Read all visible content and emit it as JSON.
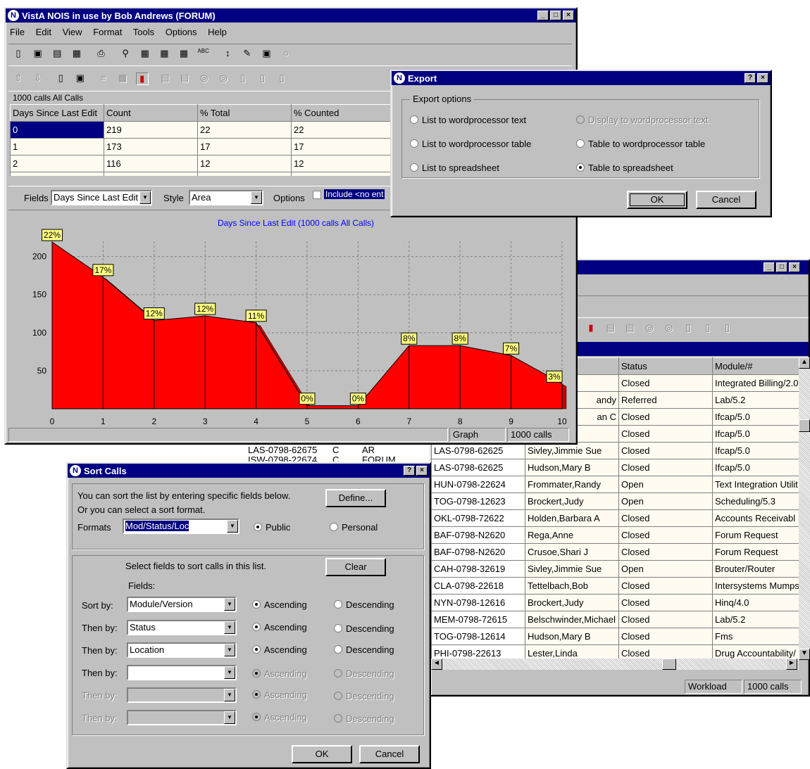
{
  "main": {
    "title": "VistA NOIS in use by Bob Andrews (FORUM)",
    "menu": [
      "File",
      "Edit",
      "View",
      "Format",
      "Tools",
      "Options",
      "Help"
    ],
    "summary": "1000 calls  All Calls",
    "columns": [
      "Days Since Last Edit",
      "Count",
      "% Total",
      "% Counted"
    ],
    "rows": [
      [
        "0",
        "219",
        "22",
        "22"
      ],
      [
        "1",
        "173",
        "17",
        "17"
      ],
      [
        "2",
        "116",
        "12",
        "12"
      ]
    ],
    "fields_label": "Fields",
    "fields_value": "Days Since Last Edit",
    "style_label": "Style",
    "style_value": "Area",
    "options_label": "Options",
    "options_check": "Include <no ent",
    "status_mode": "Graph",
    "status_count": "1000 calls"
  },
  "chart_data": {
    "type": "area",
    "title": "Days Since Last Edit (1000 calls   All Calls)",
    "x": [
      0,
      1,
      2,
      3,
      4,
      5,
      6,
      7,
      8,
      9,
      10
    ],
    "values": [
      219,
      173,
      116,
      122,
      113,
      4,
      4,
      83,
      83,
      70,
      33
    ],
    "labels": [
      "22%",
      "17%",
      "12%",
      "12%",
      "11%",
      "0%",
      "0%",
      "8%",
      "8%",
      "7%",
      "3%"
    ],
    "yticks": [
      50,
      100,
      150,
      200
    ],
    "ylim": [
      0,
      220
    ],
    "xlim": [
      0,
      10
    ],
    "grid": true,
    "fill_color": "#ff0000",
    "label_bg": "#ffff80"
  },
  "export": {
    "title": "Export",
    "group": "Export options",
    "opt_list_wp_text": "List to wordprocessor text",
    "opt_display_wp_text": "Display to wordprocessor text",
    "opt_list_wp_table": "List to wordprocessor table",
    "opt_table_wp_table": "Table to wordprocessor table",
    "opt_list_ss": "List to spreadsheet",
    "opt_table_ss": "Table to spreadsheet",
    "ok": "OK",
    "cancel": "Cancel"
  },
  "list": {
    "columns": [
      "",
      "Status",
      "Module/#"
    ],
    "rows": [
      [
        "",
        "Closed",
        "Integrated Billing/2.0"
      ],
      [
        "andy",
        "Referred",
        "Lab/5.2"
      ],
      [
        "an C",
        "Closed",
        "Ifcap/5.0"
      ],
      [
        "",
        "Closed",
        "Ifcap/5.0"
      ],
      [
        "LAS-0798-62625",
        "Sivley,Jimmie Sue",
        "Closed",
        "Ifcap/5.0"
      ],
      [
        "LAS-0798-62625",
        "Hudson,Mary B",
        "Closed",
        "Ifcap/5.0"
      ],
      [
        "HUN-0798-22624",
        "Frommater,Randy",
        "Open",
        "Text Integration Utilit"
      ],
      [
        "TOG-0798-12623",
        "Brockert,Judy",
        "Open",
        "Scheduling/5.3"
      ],
      [
        "OKL-0798-72622",
        "Holden,Barbara A",
        "Closed",
        "Accounts Receivabl"
      ],
      [
        "BAF-0798-N2620",
        "Rega,Anne",
        "Closed",
        "Forum Request"
      ],
      [
        "BAF-0798-N2620",
        "Crusoe,Shari J",
        "Closed",
        "Forum Request"
      ],
      [
        "CAH-0798-32619",
        "Sivley,Jimmie Sue",
        "Open",
        "Brouter/Router"
      ],
      [
        "CLA-0798-22618",
        "Tettelbach,Bob",
        "Closed",
        "Intersystems Mumps"
      ],
      [
        "NYN-0798-12616",
        "Brockert,Judy",
        "Closed",
        "Hinq/4.0"
      ],
      [
        "MEM-0798-72615",
        "Belschwinder,Michael",
        "Closed",
        "Lab/5.2"
      ],
      [
        "TOG-0798-12614",
        "Hudson,Mary B",
        "Closed",
        "Fms"
      ],
      [
        "PHI-0798-22613",
        "Lester,Linda",
        "Closed",
        "Drug Accountability/"
      ]
    ],
    "peek1": [
      "LAS-0798-62675",
      "C",
      "AR"
    ],
    "peek2": [
      "ISW-0798-22674",
      "C",
      "FORUM"
    ],
    "status_mode": "Workload",
    "status_count": "1000 calls"
  },
  "sort": {
    "title": "Sort Calls",
    "intro1": "You can sort the list by entering specific fields below.",
    "intro2": "Or you can select a sort format.",
    "define": "Define...",
    "formats_label": "Formats",
    "format_value": "Mod/Status/Loc",
    "public": "Public",
    "personal": "Personal",
    "select_text": "Select fields to sort calls in this list.",
    "clear": "Clear",
    "fields_label": "Fields:",
    "sort_by": "Sort by:",
    "then_by": "Then by:",
    "ascending": "Ascending",
    "descending": "Descending",
    "f1": "Module/Version",
    "f2": "Status",
    "f3": "Location",
    "ok": "OK",
    "cancel": "Cancel"
  }
}
